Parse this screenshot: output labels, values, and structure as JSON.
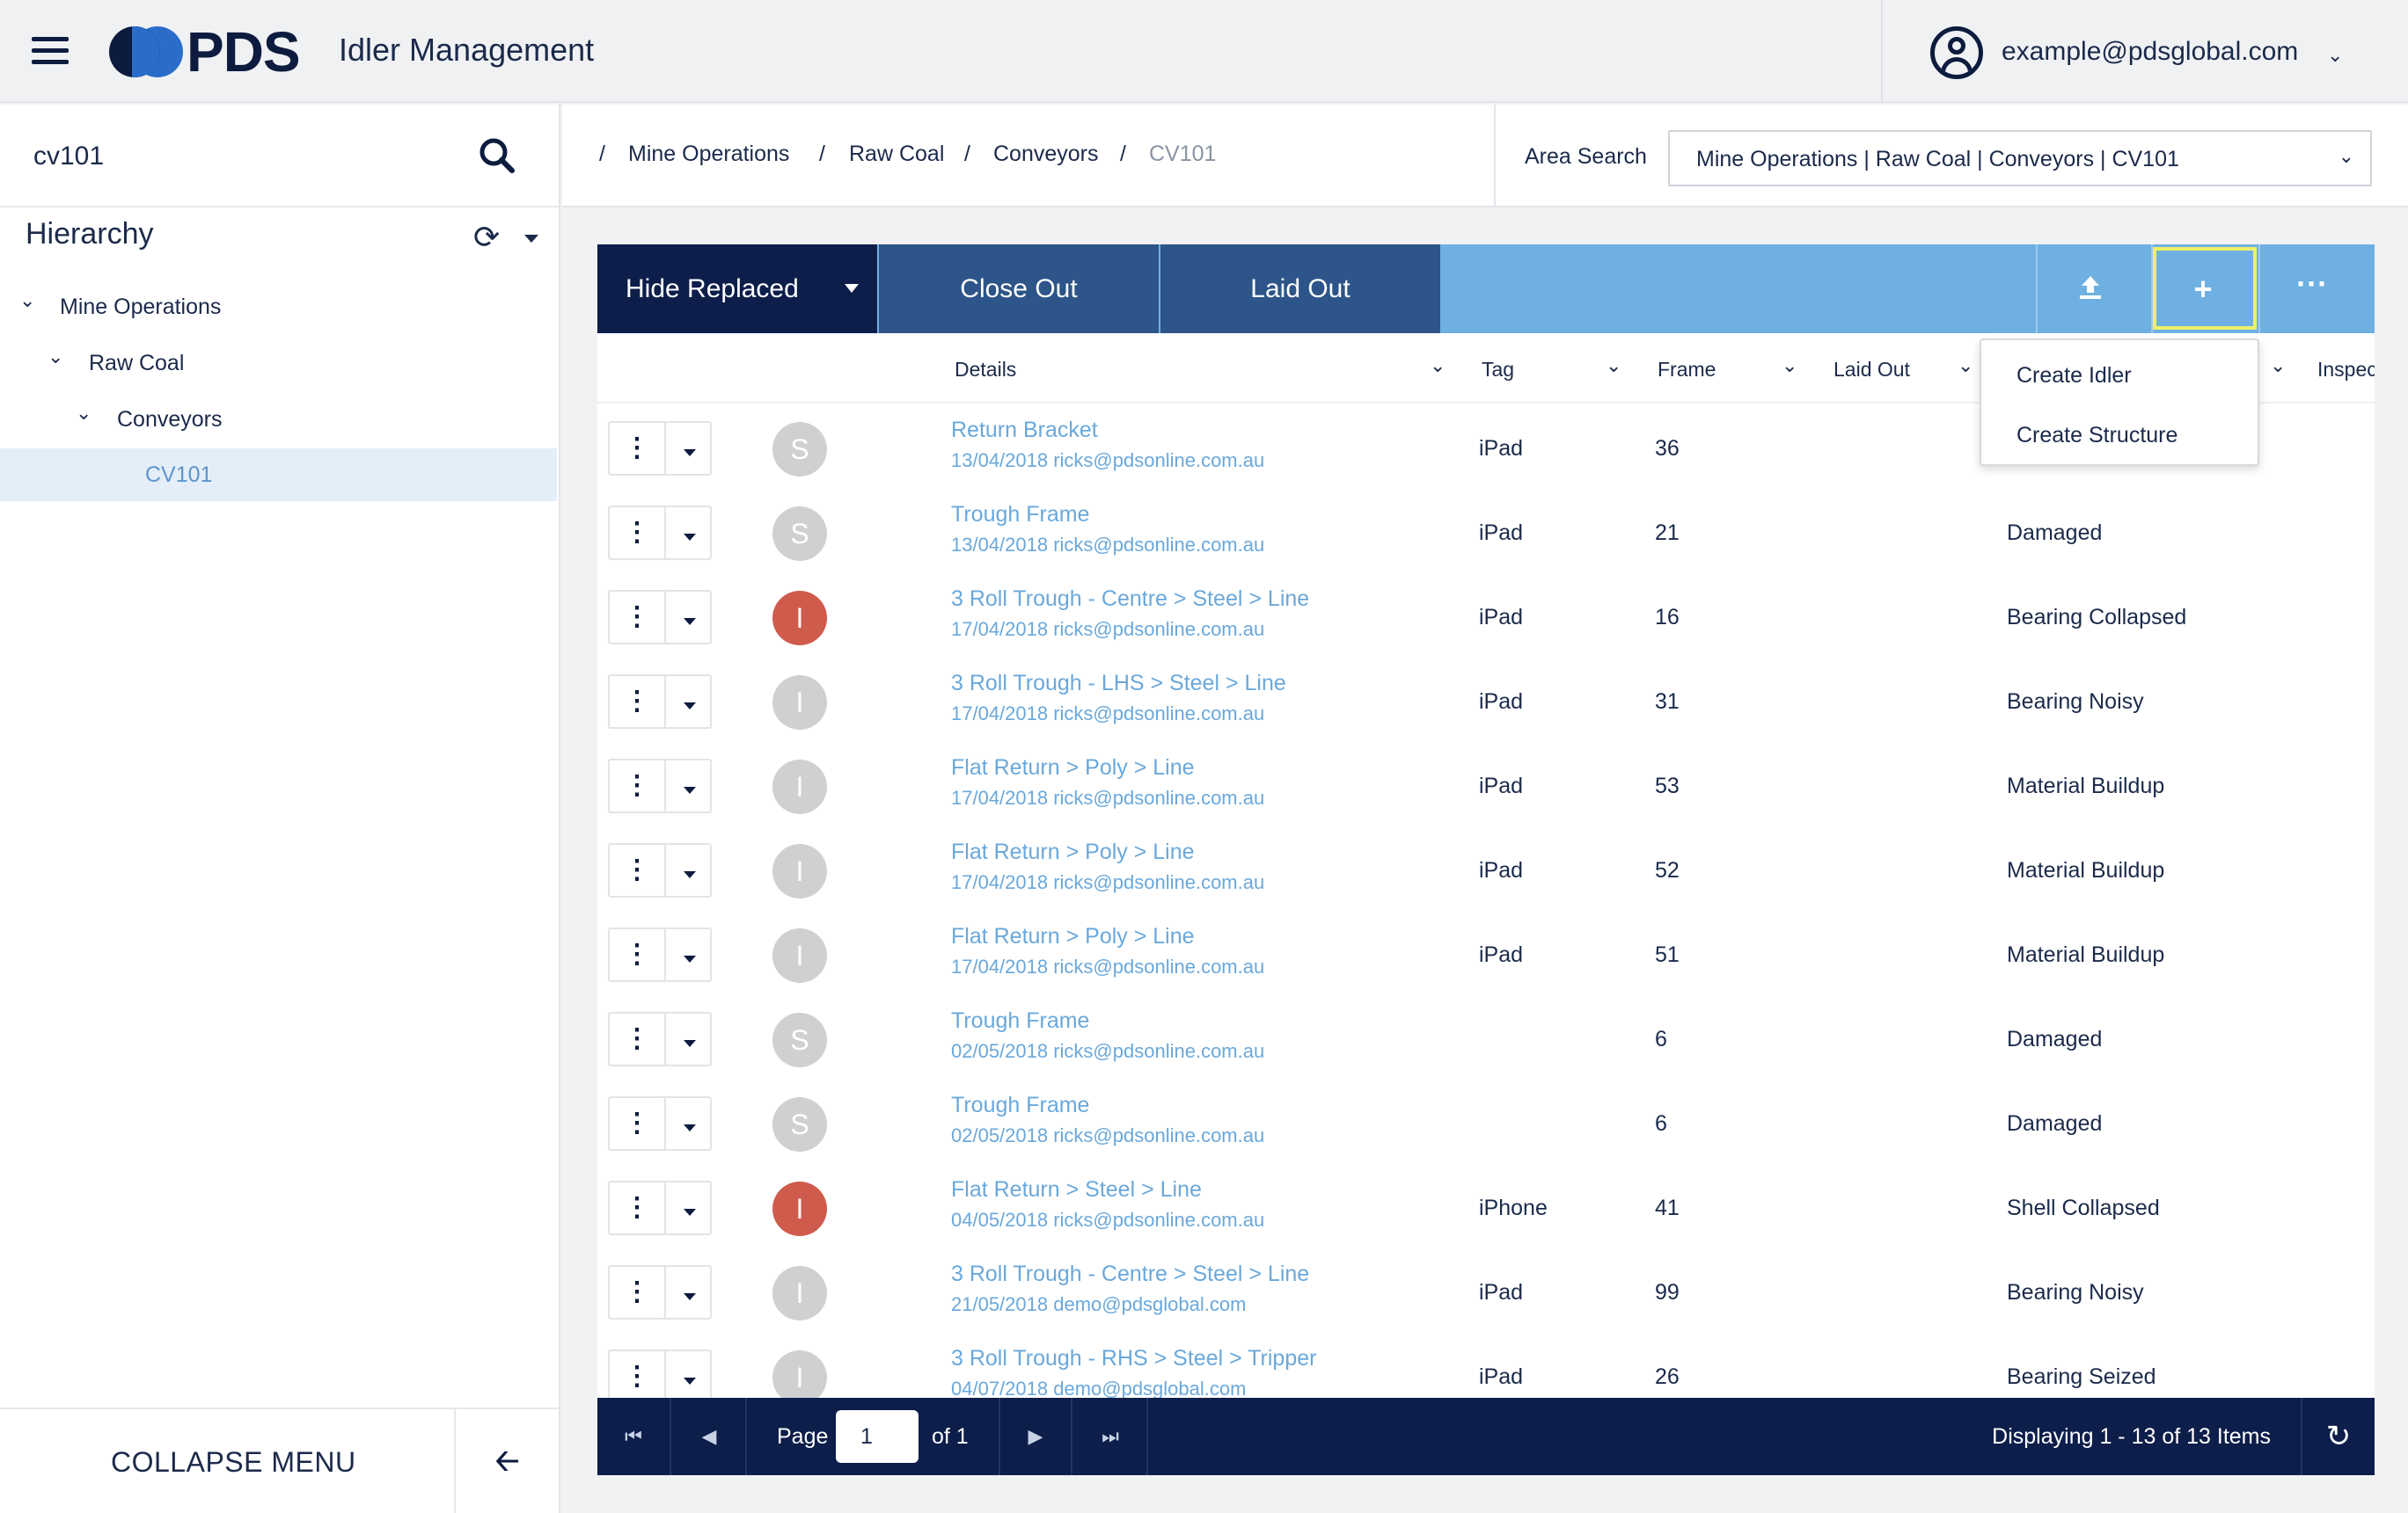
{
  "app": {
    "logo_text": "PDS",
    "title": "Idler Management"
  },
  "user": {
    "email": "example@pdsglobal.com"
  },
  "sidebar": {
    "search_value": "cv101",
    "hierarchy_title": "Hierarchy",
    "tree": [
      {
        "label": "Mine Operations",
        "level": 0,
        "expanded": true
      },
      {
        "label": "Raw Coal",
        "level": 1,
        "expanded": true
      },
      {
        "label": "Conveyors",
        "level": 2,
        "expanded": true
      },
      {
        "label": "CV101",
        "level": 3,
        "selected": true
      }
    ],
    "collapse_label": "COLLAPSE MENU"
  },
  "breadcrumb": {
    "items": [
      "Mine Operations",
      "Raw Coal",
      "Conveyors",
      "CV101"
    ],
    "separator": "/"
  },
  "area_search": {
    "label": "Area Search",
    "value": "Mine Operations | Raw Coal | Conveyors | CV101"
  },
  "toolbar": {
    "hide_replaced": "Hide Replaced",
    "close_out": "Close Out",
    "laid_out": "Laid Out",
    "icons": [
      "upload-icon",
      "plus-icon",
      "more-horizontal-icon"
    ]
  },
  "add_menu": {
    "items": [
      "Create Idler",
      "Create Structure"
    ]
  },
  "columns": {
    "details": "Details",
    "tag": "Tag",
    "frame": "Frame",
    "laid_out": "Laid Out",
    "inspection": "Inspec"
  },
  "rows": [
    {
      "badge": "S",
      "badge_color": "#cfd0d2",
      "title": "Return Bracket",
      "sub": "13/04/2018 ricks@pdsonline.com.au",
      "tag": "iPad",
      "frame": "36",
      "condition": ""
    },
    {
      "badge": "S",
      "badge_color": "#cfd0d2",
      "title": "Trough Frame",
      "sub": "13/04/2018 ricks@pdsonline.com.au",
      "tag": "iPad",
      "frame": "21",
      "condition": "Damaged"
    },
    {
      "badge": "I",
      "badge_color": "#cf5b4c",
      "title": "3 Roll Trough - Centre > Steel > Line",
      "sub": "17/04/2018 ricks@pdsonline.com.au",
      "tag": "iPad",
      "frame": "16",
      "condition": "Bearing Collapsed"
    },
    {
      "badge": "I",
      "badge_color": "#cfd0d2",
      "title": "3 Roll Trough - LHS > Steel > Line",
      "sub": "17/04/2018 ricks@pdsonline.com.au",
      "tag": "iPad",
      "frame": "31",
      "condition": "Bearing Noisy"
    },
    {
      "badge": "I",
      "badge_color": "#cfd0d2",
      "title": "Flat Return > Poly > Line",
      "sub": "17/04/2018 ricks@pdsonline.com.au",
      "tag": "iPad",
      "frame": "53",
      "condition": "Material Buildup"
    },
    {
      "badge": "I",
      "badge_color": "#cfd0d2",
      "title": "Flat Return > Poly > Line",
      "sub": "17/04/2018 ricks@pdsonline.com.au",
      "tag": "iPad",
      "frame": "52",
      "condition": "Material Buildup"
    },
    {
      "badge": "I",
      "badge_color": "#cfd0d2",
      "title": "Flat Return > Poly > Line",
      "sub": "17/04/2018 ricks@pdsonline.com.au",
      "tag": "iPad",
      "frame": "51",
      "condition": "Material Buildup"
    },
    {
      "badge": "S",
      "badge_color": "#cfd0d2",
      "title": "Trough Frame",
      "sub": "02/05/2018 ricks@pdsonline.com.au",
      "tag": "",
      "frame": "6",
      "condition": "Damaged"
    },
    {
      "badge": "S",
      "badge_color": "#cfd0d2",
      "title": "Trough Frame",
      "sub": "02/05/2018 ricks@pdsonline.com.au",
      "tag": "",
      "frame": "6",
      "condition": "Damaged"
    },
    {
      "badge": "I",
      "badge_color": "#cf5b4c",
      "title": "Flat Return > Steel > Line",
      "sub": "04/05/2018 ricks@pdsonline.com.au",
      "tag": "iPhone",
      "frame": "41",
      "condition": "Shell Collapsed"
    },
    {
      "badge": "I",
      "badge_color": "#cfd0d2",
      "title": "3 Roll Trough - Centre > Steel > Line",
      "sub": "21/05/2018 demo@pdsglobal.com",
      "tag": "iPad",
      "frame": "99",
      "condition": "Bearing Noisy"
    },
    {
      "badge": "I",
      "badge_color": "#cfd0d2",
      "title": "3 Roll Trough - RHS > Steel > Tripper",
      "sub": "04/07/2018 demo@pdsglobal.com",
      "tag": "iPad",
      "frame": "26",
      "condition": "Bearing Seized"
    }
  ],
  "pager": {
    "page_label": "Page",
    "page_value": "1",
    "of_label": "of 1",
    "display": "Displaying 1 - 13 of 13 Items"
  },
  "colors": {
    "navy": "#0d1e4a",
    "toolbar_blue": "#6eb0e2",
    "button_blue": "#2d5589",
    "link_blue": "#6aa8db",
    "alert_red": "#cf5b4c",
    "highlight_yellow": "#eef06a"
  }
}
